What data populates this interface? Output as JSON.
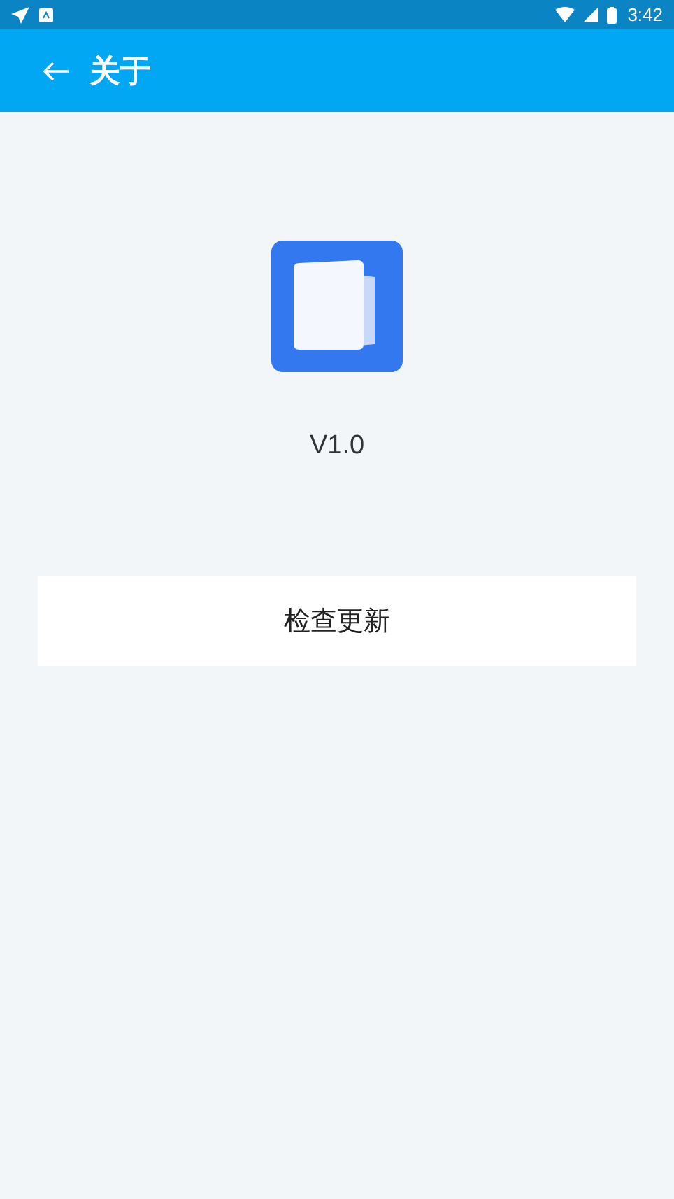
{
  "status_bar": {
    "time": "3:42"
  },
  "app_bar": {
    "title": "关于"
  },
  "version": "V1.0",
  "buttons": [
    "检查更新"
  ]
}
